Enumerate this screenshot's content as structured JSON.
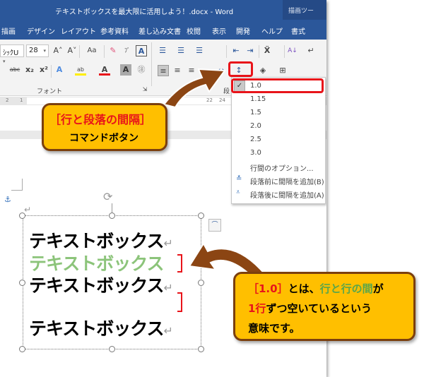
{
  "window": {
    "title": "テキストボックスを最大限に活用しよう！.docx  -  Word",
    "contextual_tab_group": "描画ツー"
  },
  "tabs": [
    "描画",
    "デザイン",
    "レイアウト",
    "参考資料",
    "差し込み文書",
    "校閲",
    "表示",
    "開発",
    "ヘルプ",
    "書式"
  ],
  "ribbon": {
    "font_name": "ｼｯｸU",
    "font_size": "28",
    "font_group_label": "フォント",
    "paragraph_group_label_partial": "段",
    "icons": {
      "grow_font": "A˄",
      "shrink_font": "A˅",
      "change_case": "Aa",
      "clear_format": "eraser-icon",
      "phonetic": "ﾌﾞ",
      "char_border": "A",
      "strikethrough": "abc",
      "subscript": "x₂",
      "superscript": "x²",
      "text_effect": "A",
      "highlight": "ab",
      "font_color": "A",
      "char_shading": "A",
      "enclose_char": "㊟"
    }
  },
  "ruler": {
    "ticks_left": [
      "2",
      "1"
    ],
    "ticks_right": [
      "22",
      "24"
    ]
  },
  "line_spacing_menu": {
    "options": [
      "1.0",
      "1.15",
      "1.5",
      "2.0",
      "2.5",
      "3.0"
    ],
    "selected": "1.0",
    "more_options": "行間のオプション...",
    "add_space_before": "段落前に間隔を追加(B)",
    "add_space_after": "段落後に間隔を追加(A)"
  },
  "callout_top": {
    "line1": "［行と段落の間隔］",
    "line2": "コマンドボタン"
  },
  "textbox": {
    "lines": [
      "テキストボックス",
      "テキストボックス",
      "テキストボックス",
      "テキストボックス"
    ],
    "return_mark": "↵"
  },
  "callout_bottom": {
    "p1_red": "［1.0］",
    "p1_black": "とは、",
    "p1_green": "行と行の間",
    "p1_tail": "が",
    "p2_red": "1行",
    "p2_black": "ずつ空いているという",
    "p3": "意味です。"
  },
  "colors": {
    "ribbon_blue": "#2b579a",
    "highlight_red": "#e8141a",
    "callout_fill": "#ffbf00",
    "callout_border": "#7b3f0e",
    "arrow_brown": "#8b4513",
    "text_green": "#5aa64a"
  }
}
